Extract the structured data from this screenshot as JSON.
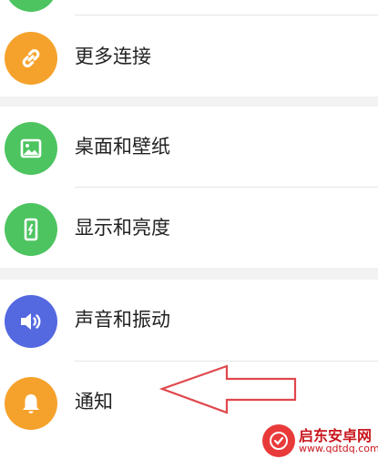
{
  "settings": {
    "items": [
      {
        "label": "更多连接",
        "icon": "link-icon",
        "color": "#f5a22c"
      },
      {
        "label": "桌面和壁纸",
        "icon": "image-icon",
        "color": "#4dc460"
      },
      {
        "label": "显示和亮度",
        "icon": "phone-brightness-icon",
        "color": "#4dc460"
      },
      {
        "label": "声音和振动",
        "icon": "speaker-icon",
        "color": "#5468e0"
      },
      {
        "label": "通知",
        "icon": "bell-icon",
        "color": "#f5a22c"
      }
    ]
  },
  "annotation": {
    "arrow_color": "#e0474c"
  },
  "watermark": {
    "name": "启东安卓网",
    "url": "www.qdtdq.com"
  }
}
